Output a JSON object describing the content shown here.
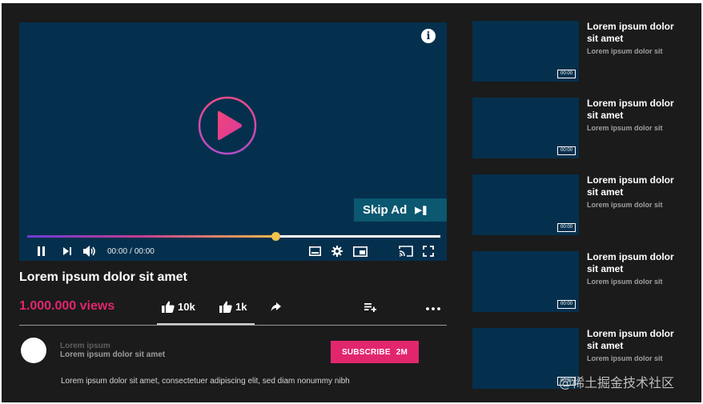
{
  "player": {
    "skip_ad_label": "Skip Ad",
    "current_time": "00:00",
    "total_time": "00:00",
    "time_separator": "/",
    "progress": 0.6,
    "accent_gradient": [
      "#6d3bd6",
      "#c23c93",
      "#f0b94b"
    ],
    "icons": [
      "info-icon",
      "play-icon",
      "pause-icon",
      "next-icon",
      "volume-icon",
      "captions-icon",
      "settings-icon",
      "miniplayer-icon",
      "cast-icon",
      "fullscreen-icon"
    ]
  },
  "video": {
    "title": "Lorem ipsum dolor sit amet",
    "views": "1.000.000 views",
    "likes": "10k",
    "dislikes": "1k",
    "action_icons": [
      "thumbs-up-icon",
      "thumbs-up-icon",
      "share-icon",
      "add-to-playlist-icon",
      "more-icon"
    ]
  },
  "channel": {
    "name": "Lorem ipsum",
    "subtitle": "Lorem ipsum dolor sit amet",
    "subscribe_label": "SUBSCRIBE",
    "subscriber_count": "2M",
    "description": "Lorem ipsum dolor sit amet, consectetuer adipiscing elit, sed diam nonummy nibh"
  },
  "recommended": [
    {
      "title": "Lorem ipsum dolor sit amet",
      "channel": "Lorem ipsum dolor sit",
      "duration": "00:00"
    },
    {
      "title": "Lorem ipsum dolor sit amet",
      "channel": "Lorem ipsum dolor sit",
      "duration": "00:00"
    },
    {
      "title": "Lorem ipsum dolor sit amet",
      "channel": "Lorem ipsum dolor sit",
      "duration": "00:00"
    },
    {
      "title": "Lorem ipsum dolor sit amet",
      "channel": "Lorem ipsum dolor sit",
      "duration": "00:00"
    },
    {
      "title": "Lorem ipsum dolor sit amet",
      "channel": "Lorem ipsum dolor sit",
      "duration": "00:00"
    }
  ],
  "colors": {
    "background": "#1b1b1b",
    "video_surface": "#05304d",
    "accent_pink": "#e2266e",
    "skip_ad_bg": "#0b5870"
  },
  "watermark": "@稀土掘金技术社区"
}
